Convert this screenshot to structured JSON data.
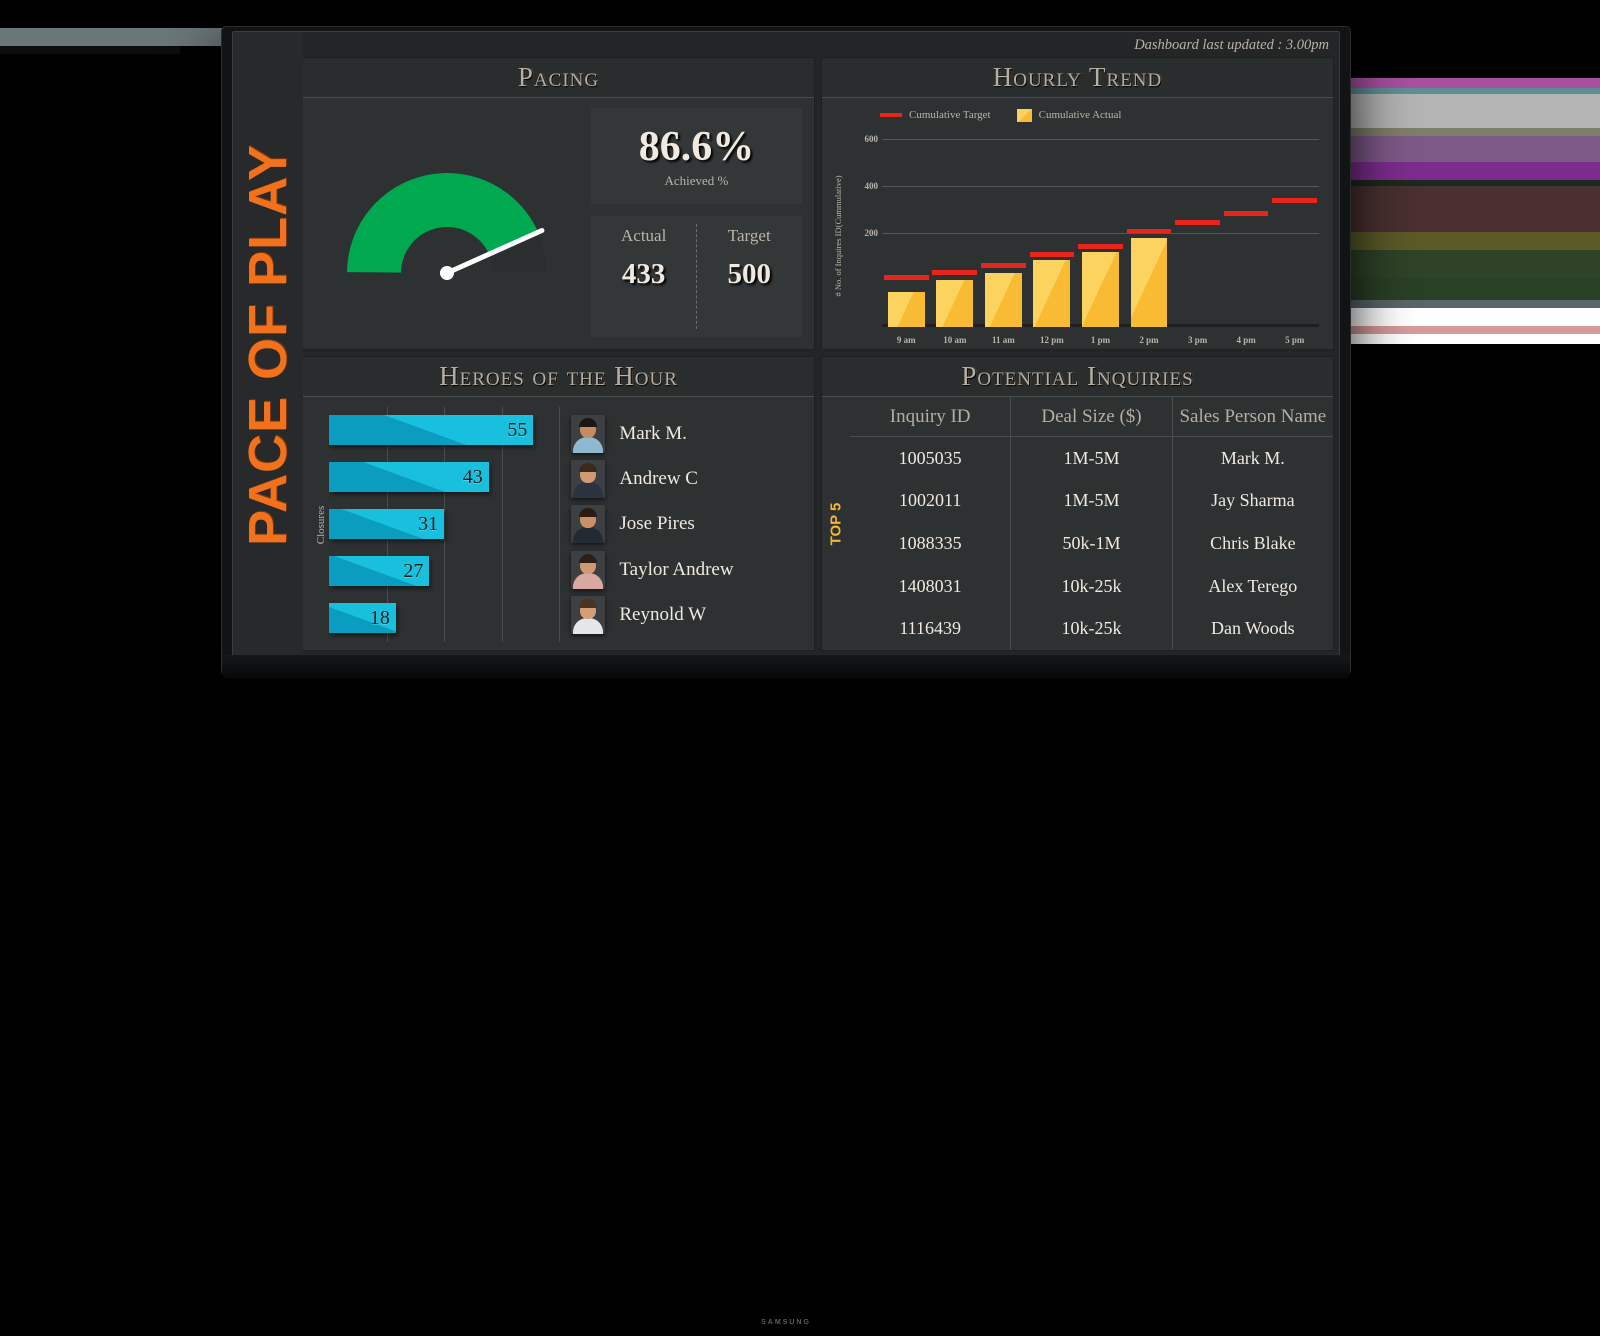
{
  "header": {
    "last_updated": "Dashboard last updated : 3.00pm",
    "vertical_title": "PACE OF PLAY",
    "monitor_brand": "SAMSUNG"
  },
  "colors": {
    "accent_orange": "#f2711c",
    "gauge_green": "#00a94f",
    "bar_yellow": "#f9bb33",
    "target_red": "#e8241c",
    "hero_cyan": "#0a9dc0",
    "top5_gold": "#f2b632",
    "panel_bg": "#2e3132",
    "dashboard_bg": "#232526",
    "text_cream": "#efe9df",
    "text_muted": "#b9b3a8"
  },
  "panels": {
    "pacing": {
      "title": "Pacing",
      "percent": "86.6%",
      "percent_label": "Achieved %",
      "actual_label": "Actual",
      "actual_value": "433",
      "target_label": "Target",
      "target_value": "500"
    },
    "hourly_trend": {
      "title": "Hourly Trend"
    },
    "heroes": {
      "title": "Heroes  of the Hour",
      "axis_label": "Closures"
    },
    "inquiries": {
      "title": "Potential Inquiries",
      "rail_label": "TOP 5",
      "columns": [
        "Inquiry ID",
        "Deal Size ($)",
        "Sales Person Name"
      ],
      "rows": [
        [
          "1005035",
          "1M-5M",
          "Mark M."
        ],
        [
          "1002011",
          "1M-5M",
          "Jay Sharma"
        ],
        [
          "1088335",
          "50k-1M",
          "Chris Blake"
        ],
        [
          "1408031",
          "10k-25k",
          "Alex Terego"
        ],
        [
          "1116439",
          "10k-25k",
          "Dan Woods"
        ]
      ]
    }
  },
  "chart_data": [
    {
      "type": "bar",
      "id": "hourly-trend",
      "title": "Hourly Trend",
      "xlabel": "",
      "ylabel": "# No. of Inquires ID(Cummulative)",
      "categories": [
        "9 am",
        "10 am",
        "11 am",
        "12 pm",
        "1 pm",
        "2 pm",
        "3 pm",
        "4 pm",
        "5 pm"
      ],
      "ylim": [
        0,
        640
      ],
      "yticks": [
        200,
        400,
        600
      ],
      "grid": true,
      "legend_position": "top-left",
      "series": [
        {
          "name": "Cumulative Actual",
          "type": "bar",
          "color": "#f9bb33",
          "values": [
            150,
            200,
            232,
            287,
            320,
            380,
            null,
            null,
            null
          ]
        },
        {
          "name": "Cumulative Target",
          "type": "marker-line",
          "color": "#e8241c",
          "values": [
            200,
            222,
            252,
            298,
            332,
            395,
            437,
            472,
            527
          ]
        }
      ]
    },
    {
      "type": "bar",
      "id": "heroes-of-the-hour",
      "title": "Heroes  of the Hour",
      "orientation": "horizontal",
      "xlabel": "",
      "ylabel": "Closures",
      "categories": [
        "Mark M.",
        "Andrew C",
        "Jose Pires",
        "Taylor Andrew",
        "Reynold W"
      ],
      "values": [
        55,
        43,
        31,
        27,
        18
      ],
      "color": "#0a9dc0",
      "xlim": [
        0,
        62
      ],
      "grid": true
    },
    {
      "type": "gauge",
      "id": "pacing-gauge",
      "title": "Pacing",
      "value": 86.6,
      "unit": "%",
      "min": 0,
      "max": 100,
      "actual": 433,
      "target": 500,
      "fill_color": "#00a94f",
      "track_color": "#2b2e2f",
      "needle_color": "#ffffff"
    }
  ],
  "trend_legend": [
    {
      "label": "Cumulative Target",
      "marker": "line"
    },
    {
      "label": "Cumulative Actual",
      "marker": "square"
    }
  ],
  "heroes_people": [
    {
      "name": "Mark M.",
      "skin": "#c58b63",
      "hair": "#1d1510",
      "shirt": "#8fb7cf"
    },
    {
      "name": "Andrew C",
      "skin": "#cf9a74",
      "hair": "#3a2a1c",
      "shirt": "#2b3240"
    },
    {
      "name": "Jose Pires",
      "skin": "#cb9065",
      "hair": "#2a1c12",
      "shirt": "#242a33"
    },
    {
      "name": "Taylor Andrew",
      "skin": "#d09a70",
      "hair": "#2e2018",
      "shirt": "#d9a8a0"
    },
    {
      "name": "Reynold W",
      "skin": "#d2a077",
      "hair": "#4a3321",
      "shirt": "#e4e6e8"
    }
  ],
  "background_bands": [
    {
      "top": 78,
      "height": 10,
      "color": "#a94fa0"
    },
    {
      "top": 88,
      "height": 6,
      "color": "#5f8f96"
    },
    {
      "top": 94,
      "height": 34,
      "color": "#b4b4b4"
    },
    {
      "top": 128,
      "height": 8,
      "color": "#7e7f6a"
    },
    {
      "top": 136,
      "height": 26,
      "color": "#7d5988"
    },
    {
      "top": 162,
      "height": 18,
      "color": "#7d2c8e"
    },
    {
      "top": 180,
      "height": 6,
      "color": "#1b2a1b"
    },
    {
      "top": 186,
      "height": 46,
      "color": "#4a3030"
    },
    {
      "top": 232,
      "height": 18,
      "color": "#5b5a28"
    },
    {
      "top": 250,
      "height": 28,
      "color": "#2e4328"
    },
    {
      "top": 278,
      "height": 22,
      "color": "#2a4026"
    },
    {
      "top": 300,
      "height": 8,
      "color": "#5b666a"
    },
    {
      "top": 308,
      "height": 18,
      "color": "#ffffff"
    },
    {
      "top": 326,
      "height": 8,
      "color": "#d79a9a"
    },
    {
      "top": 334,
      "height": 10,
      "color": "#ffffff"
    }
  ]
}
